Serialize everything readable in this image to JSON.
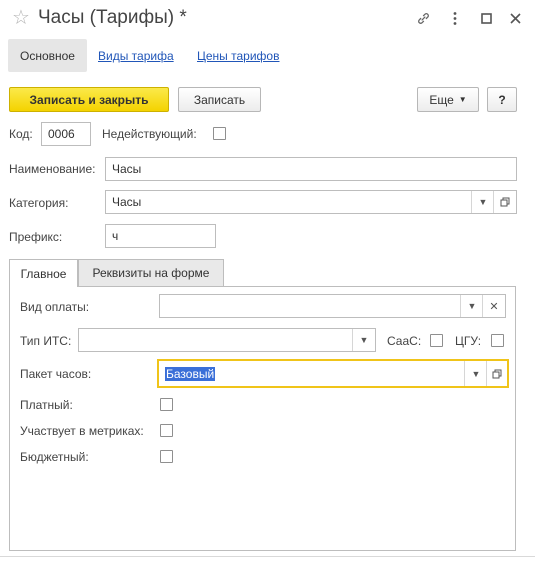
{
  "window": {
    "title": "Часы (Тарифы) *",
    "icons": [
      "star-icon",
      "link-icon",
      "more-vert-icon",
      "maximize-icon",
      "close-icon"
    ]
  },
  "nav": {
    "active": "Основное",
    "links": [
      "Виды тарифа",
      "Цены тарифов"
    ]
  },
  "toolbar": {
    "save_close_label": "Записать и закрыть",
    "save_label": "Записать",
    "more_label": "Еще",
    "help_label": "?"
  },
  "form": {
    "code_label": "Код:",
    "code_value": "0006",
    "inactive_label": "Недействующий:",
    "inactive_checked": false,
    "name_label": "Наименование:",
    "name_value": "Часы",
    "category_label": "Категория:",
    "category_value": "Часы",
    "prefix_label": "Префикс:",
    "prefix_value": "ч"
  },
  "tabs": {
    "main": "Главное",
    "requisites": "Реквизиты на форме",
    "active": "Главное"
  },
  "main_tab": {
    "payment_type_label": "Вид оплаты:",
    "payment_type_value": "",
    "its_type_label": "Тип ИТС:",
    "its_type_value": "",
    "saas_label": "СааС:",
    "saas_checked": false,
    "cgu_label": "ЦГУ:",
    "cgu_checked": false,
    "package_label": "Пакет часов:",
    "package_value": "Базовый",
    "paid_label": "Платный:",
    "paid_checked": false,
    "metrics_label": "Участвует в метриках:",
    "metrics_checked": false,
    "budget_label": "Бюджетный:",
    "budget_checked": false
  },
  "colors": {
    "accent_yellow": "#f4d300",
    "link_blue": "#2156b8",
    "focus_border": "#f0c419",
    "selection": "#3a6fd8"
  }
}
